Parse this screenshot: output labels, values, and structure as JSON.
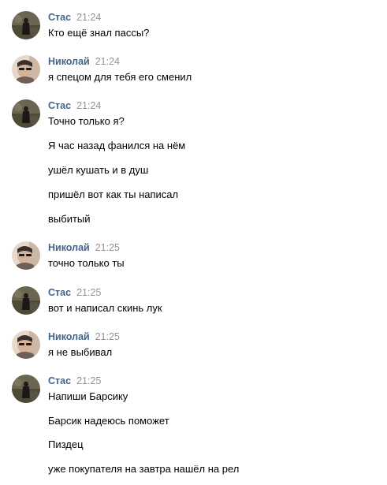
{
  "messages": [
    {
      "author": "Стас",
      "time": "21:24",
      "avatar": "stas-avatar",
      "lines": [
        "Кто ещё знал пассы?"
      ]
    },
    {
      "author": "Николай",
      "time": "21:24",
      "avatar": "nikolai-avatar",
      "lines": [
        "я спецом для тебя его сменил"
      ]
    },
    {
      "author": "Стас",
      "time": "21:24",
      "avatar": "stas-avatar",
      "lines": [
        "Точно только я?",
        "Я час назад фанился на нём",
        "ушёл кушать и в душ",
        "пришёл вот как ты написал",
        "выбитый"
      ]
    },
    {
      "author": "Николай",
      "time": "21:25",
      "avatar": "nikolai-avatar",
      "lines": [
        "точно только ты"
      ]
    },
    {
      "author": "Стас",
      "time": "21:25",
      "avatar": "stas-avatar",
      "lines": [
        "вот и написал скинь лук"
      ]
    },
    {
      "author": "Николай",
      "time": "21:25",
      "avatar": "nikolai-avatar",
      "lines": [
        "я не выбивал"
      ]
    },
    {
      "author": "Стас",
      "time": "21:25",
      "avatar": "stas-avatar",
      "lines": [
        "Напиши Барсику",
        "Барсик надеюсь поможет",
        "Пиздец",
        "уже покупателя на завтра нашёл на рел"
      ]
    }
  ],
  "colors": {
    "author": "#42648b",
    "time": "#939393",
    "text": "#000000",
    "background": "#ffffff"
  }
}
